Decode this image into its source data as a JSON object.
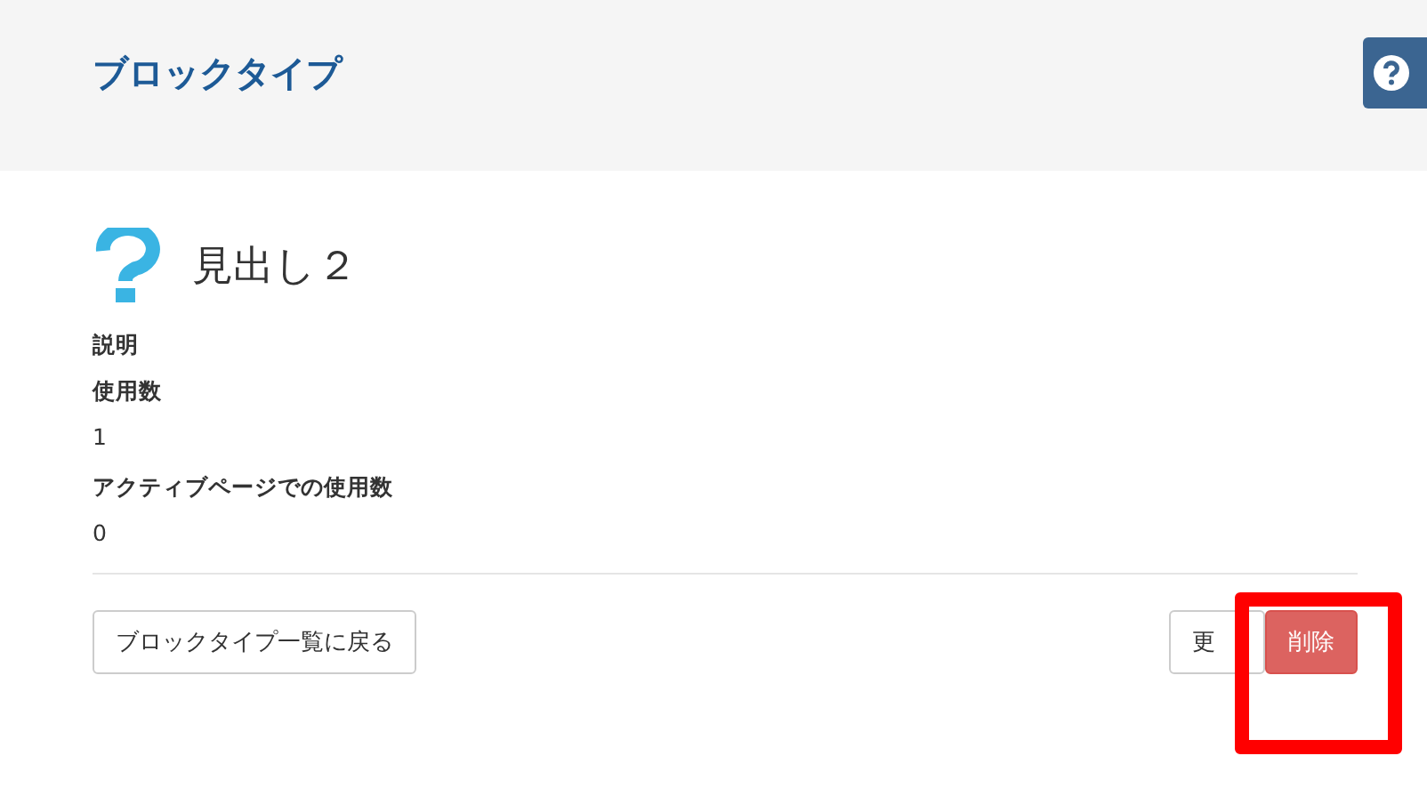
{
  "header": {
    "title": "ブロックタイプ"
  },
  "block": {
    "name": "見出し２"
  },
  "fields": [
    {
      "label": "説明"
    },
    {
      "label": "使用数",
      "value": "1"
    },
    {
      "label": "アクティブページでの使用数",
      "value": "0"
    }
  ],
  "actions": {
    "back": "ブロックタイプ一覧に戻る",
    "buttons": [
      {
        "label": "更",
        "kind": "default"
      },
      {
        "label": "削除",
        "kind": "danger"
      }
    ]
  }
}
